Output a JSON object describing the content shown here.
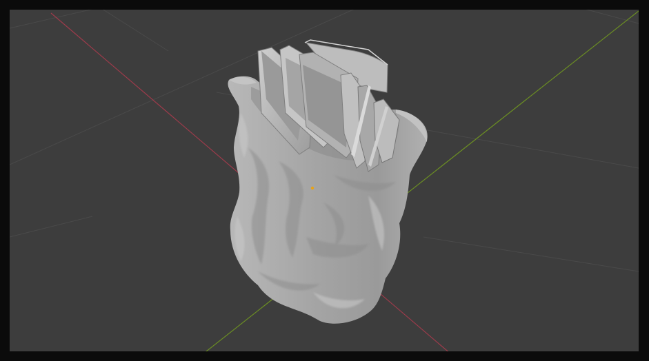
{
  "app": {
    "name": "3D viewport",
    "view": "perspective",
    "shading": "solid"
  },
  "colors": {
    "window_border": "#0b0b0b",
    "viewport_background": "#3d3d3d",
    "grid_line": "#4a4a4a",
    "x_axis": "#9e3b4b",
    "y_axis": "#6b8e23",
    "mesh": "#a9a9a9",
    "mesh_highlight": "#c9c9c9",
    "mesh_shadow": "#7a7a7a",
    "origin_marker": "#e8a317"
  },
  "scene": {
    "objects": [
      {
        "name": "sack",
        "icon": "cloth-sack-mesh"
      },
      {
        "name": "cards",
        "icon": "card-stack-mesh"
      }
    ],
    "origin_point": "object-origin-icon"
  }
}
